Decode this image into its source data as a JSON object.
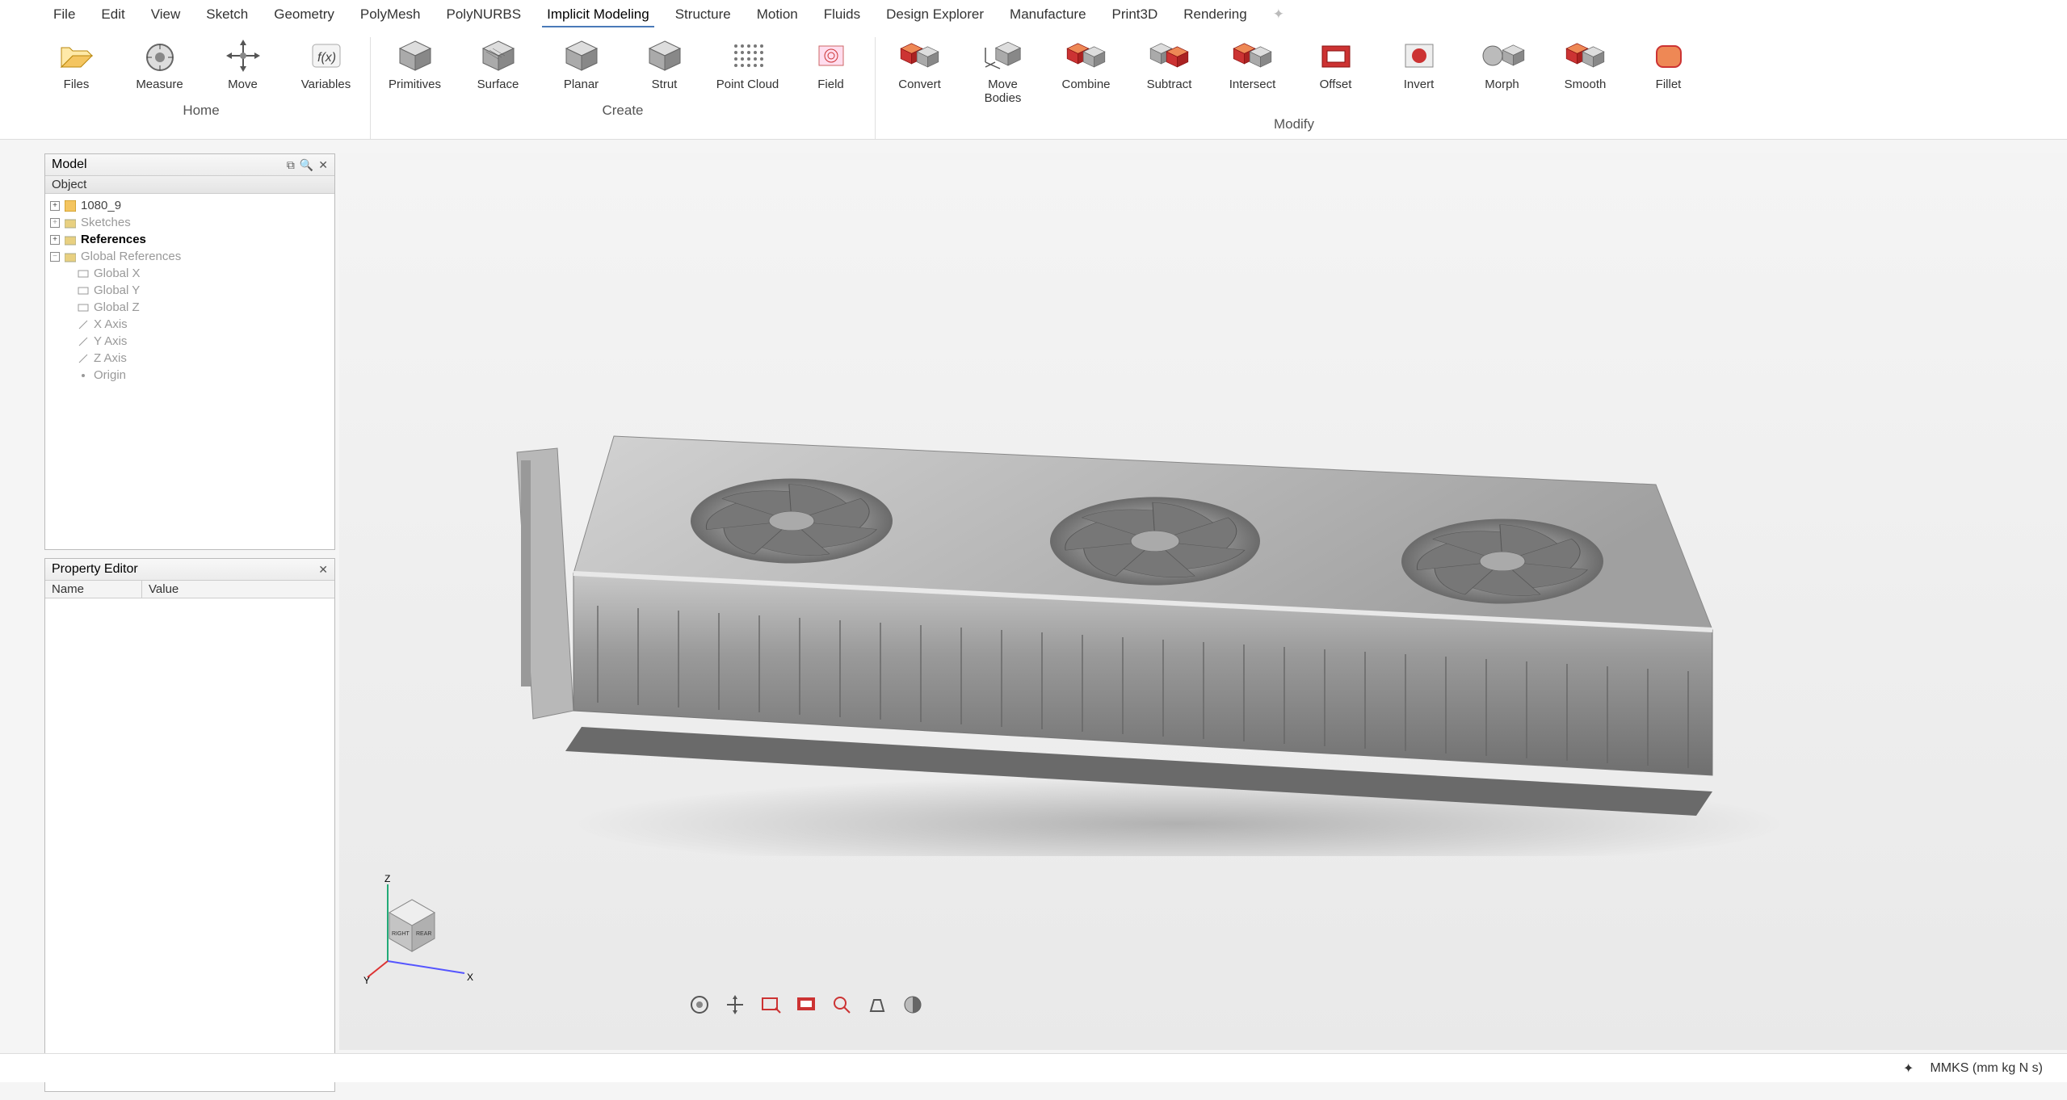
{
  "menus": [
    "File",
    "Edit",
    "View",
    "Sketch",
    "Geometry",
    "PolyMesh",
    "PolyNURBS",
    "Implicit Modeling",
    "Structure",
    "Motion",
    "Fluids",
    "Design Explorer",
    "Manufacture",
    "Print3D",
    "Rendering"
  ],
  "active_menu": "Implicit Modeling",
  "ribbon": {
    "groups": [
      {
        "label": "Home",
        "tools": [
          {
            "name": "files",
            "label": "Files"
          },
          {
            "name": "measure",
            "label": "Measure"
          },
          {
            "name": "move",
            "label": "Move"
          },
          {
            "name": "variables",
            "label": "Variables"
          }
        ]
      },
      {
        "label": "Create",
        "tools": [
          {
            "name": "primitives",
            "label": "Primitives"
          },
          {
            "name": "surface",
            "label": "Surface"
          },
          {
            "name": "planar",
            "label": "Planar"
          },
          {
            "name": "strut",
            "label": "Strut"
          },
          {
            "name": "point-cloud",
            "label": "Point Cloud"
          },
          {
            "name": "field",
            "label": "Field"
          }
        ]
      },
      {
        "label": "Modify",
        "tools": [
          {
            "name": "convert",
            "label": "Convert"
          },
          {
            "name": "move-bodies",
            "label": "Move Bodies"
          },
          {
            "name": "combine",
            "label": "Combine"
          },
          {
            "name": "subtract",
            "label": "Subtract"
          },
          {
            "name": "intersect",
            "label": "Intersect"
          },
          {
            "name": "offset",
            "label": "Offset"
          },
          {
            "name": "invert",
            "label": "Invert"
          },
          {
            "name": "morph",
            "label": "Morph"
          },
          {
            "name": "smooth",
            "label": "Smooth"
          },
          {
            "name": "fillet",
            "label": "Fillet"
          }
        ]
      }
    ]
  },
  "model_panel": {
    "title": "Model",
    "subheader": "Object",
    "items": [
      {
        "label": "1080_9",
        "icon": "part",
        "dim": false
      },
      {
        "label": "Sketches",
        "icon": "folder",
        "dim": true
      },
      {
        "label": "References",
        "icon": "folder",
        "dim": false,
        "bold": true
      },
      {
        "label": "Global References",
        "icon": "folder",
        "dim": true,
        "children": [
          {
            "label": "Global X",
            "icon": "plane"
          },
          {
            "label": "Global Y",
            "icon": "plane"
          },
          {
            "label": "Global Z",
            "icon": "plane"
          },
          {
            "label": "X Axis",
            "icon": "axis"
          },
          {
            "label": "Y Axis",
            "icon": "axis"
          },
          {
            "label": "Z Axis",
            "icon": "axis"
          },
          {
            "label": "Origin",
            "icon": "point"
          }
        ]
      }
    ]
  },
  "property_panel": {
    "title": "Property Editor",
    "cols": [
      "Name",
      "Value"
    ]
  },
  "axes": {
    "z": "Z",
    "y": "Y",
    "x": "X"
  },
  "viewcube": {
    "right": "RIGHT",
    "rear": "REAR"
  },
  "status": {
    "units": "MMKS (mm kg N s)"
  }
}
